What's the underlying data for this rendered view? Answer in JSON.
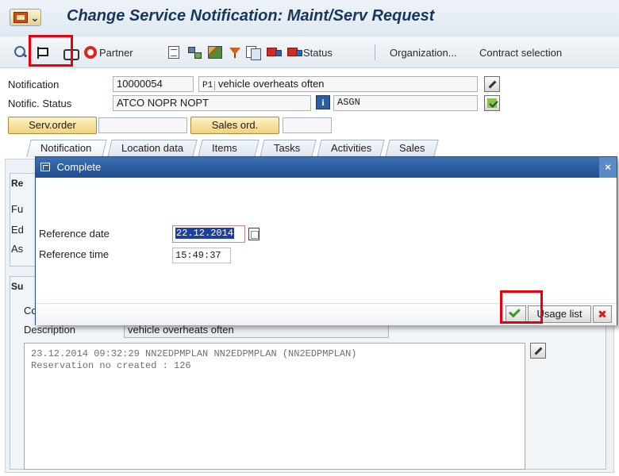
{
  "window": {
    "title": "Change Service Notification: Maint/Serv Request"
  },
  "toolbar": {
    "partner_label": "Partner",
    "status_label": "Status",
    "organization_label": "Organization...",
    "contract_label": "Contract selection",
    "icons": [
      "find-icon",
      "complete-flag-icon",
      "binoculars-icon",
      "partner-icon",
      "document-icon",
      "network-icon",
      "stack-icon",
      "funnel-icon",
      "documents-icon",
      "truck-icon",
      "truck-status-icon"
    ]
  },
  "header": {
    "notification_label": "Notification",
    "notification_number": "10000054",
    "notification_priority": "P1",
    "notification_description": "vehicle overheats often",
    "status_label": "Notific. Status",
    "status_value": "ATCO NOPR NOPT",
    "status_user": "ASGN",
    "serv_order_label": "Serv.order",
    "sales_ord_label": "Sales ord."
  },
  "tabs": [
    {
      "label": "Notification",
      "active": true
    },
    {
      "label": "Location data",
      "active": false
    },
    {
      "label": "Items",
      "active": false
    },
    {
      "label": "Tasks",
      "active": false
    },
    {
      "label": "Activities",
      "active": false
    },
    {
      "label": "Sales",
      "active": false
    }
  ],
  "background": {
    "frame1_fragment": "Re",
    "field_fragments": [
      "Fu",
      "Ed",
      "As"
    ],
    "frame2_fragment": "Su",
    "field2_fragment": "Co",
    "description_label": "Description",
    "description_value": "vehicle overheats often",
    "long_text_line1": "23.12.2014 09:32:29 NN2EDPMPLAN NN2EDPMPLAN (NN2EDPMPLAN)",
    "long_text_line2": "Reservation no created : 126"
  },
  "popup": {
    "title": "Complete",
    "reference_date_label": "Reference date",
    "reference_date_value": "22.12.2014",
    "reference_time_label": "Reference time",
    "reference_time_value": "15:49:37",
    "usage_list_label": "Usage list",
    "close_glyph": "×",
    "cancel_glyph": "✖"
  },
  "colors": {
    "highlight": "#e60012",
    "title_text": "#17365d",
    "popup_title_bg": "#1f4d8f"
  }
}
